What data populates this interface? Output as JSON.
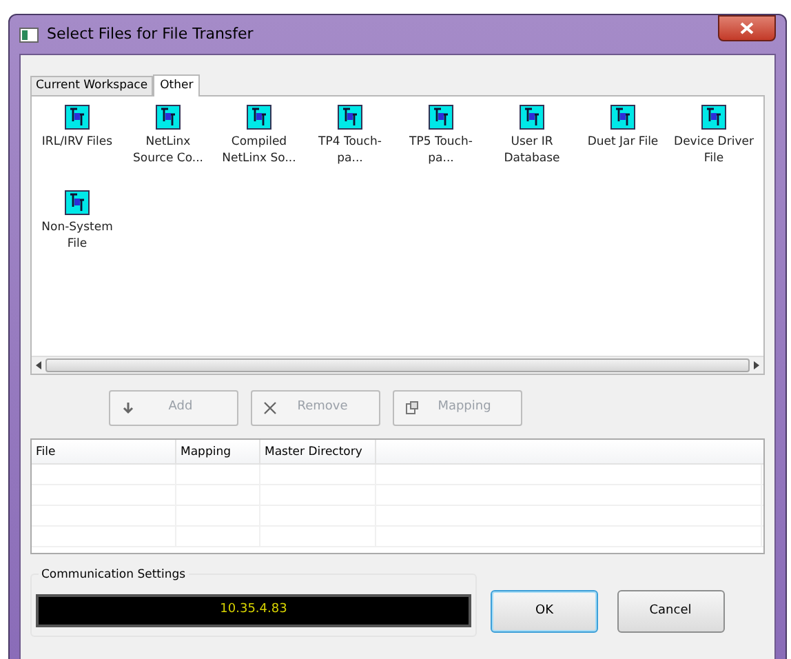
{
  "window": {
    "title": "Select Files for File Transfer"
  },
  "tabs": [
    {
      "label": "Current Workspace",
      "selected": false
    },
    {
      "label": "Other",
      "selected": true
    }
  ],
  "file_types": [
    {
      "label": "IRL/IRV Files"
    },
    {
      "label": "NetLinx Source Co..."
    },
    {
      "label": "Compiled NetLinx So..."
    },
    {
      "label": "TP4 Touch-pa..."
    },
    {
      "label": "TP5 Touch-pa..."
    },
    {
      "label": "User IR Database"
    },
    {
      "label": "Duet Jar File"
    },
    {
      "label": "Device Driver File"
    },
    {
      "label": "Non-System File"
    }
  ],
  "buttons": [
    {
      "label": "Add",
      "kind": "add",
      "disabled": true
    },
    {
      "label": "Remove",
      "kind": "remove",
      "disabled": true
    },
    {
      "label": "Mapping",
      "kind": "mapping",
      "disabled": true
    }
  ],
  "table": {
    "columns": [
      "File",
      "Mapping",
      "Master Directory"
    ]
  },
  "communication_settings": {
    "title": "Communication Settings",
    "address": "10.35.4.83"
  },
  "dialog_buttons": [
    {
      "label": "OK",
      "default": true
    },
    {
      "label": "Cancel",
      "default": false
    }
  ]
}
